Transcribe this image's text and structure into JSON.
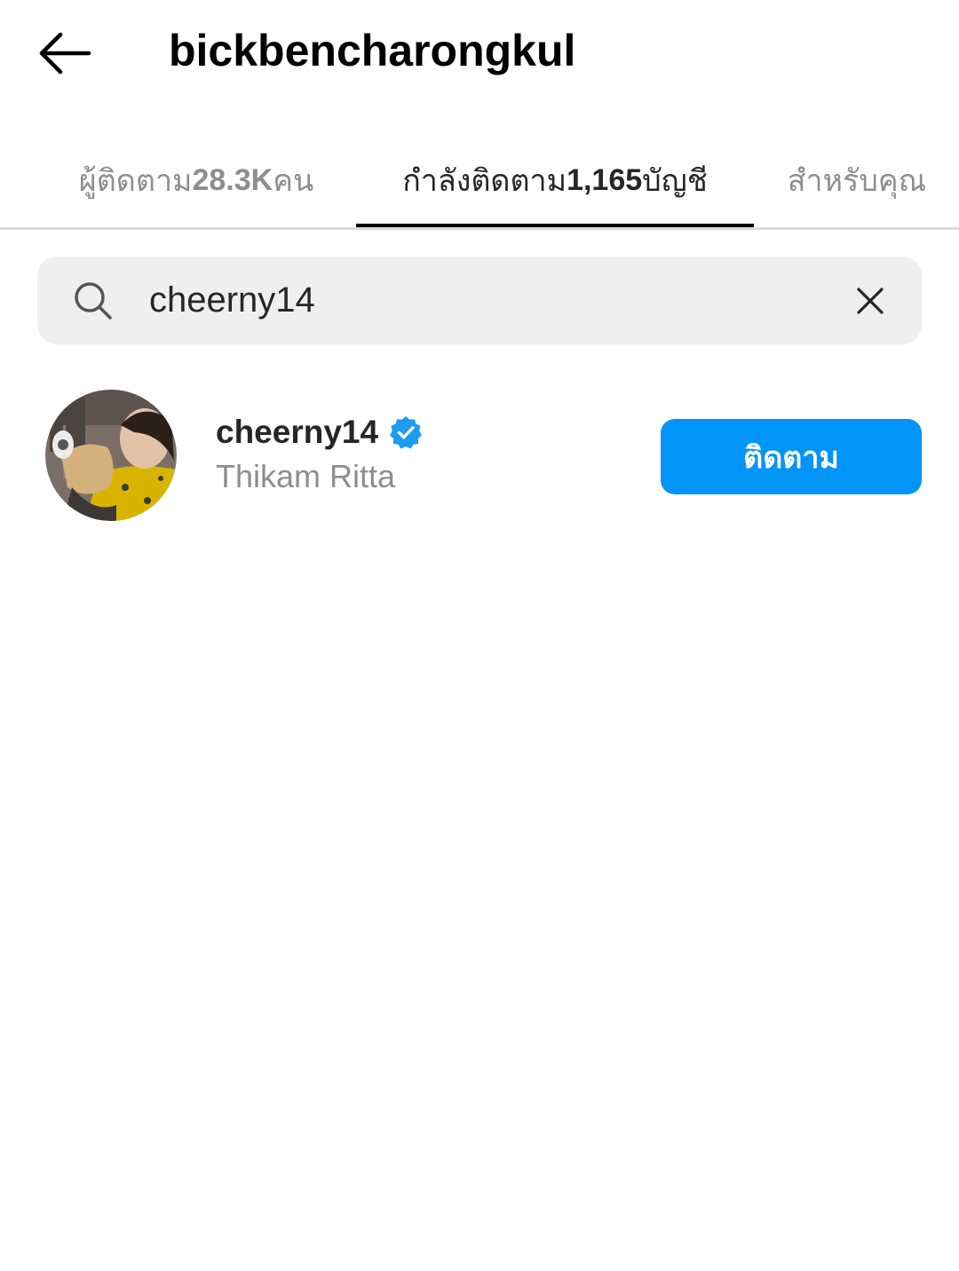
{
  "header": {
    "title": "bickbencharongkul",
    "back_icon": "arrow-left-icon"
  },
  "tabs": {
    "partial_label": "ı",
    "items": [
      {
        "label_before": "ผู้ติดตาม ",
        "count": "28.3K",
        "label_after": " คน",
        "active": false
      },
      {
        "label_before": "กำลังติดตาม ",
        "count": "1,165",
        "label_after": " บัญชี",
        "active": true
      },
      {
        "label_before": "สำหรับคุณ",
        "count": "",
        "label_after": "",
        "active": false
      }
    ]
  },
  "search": {
    "value": "cheerny14",
    "search_icon": "search-icon",
    "clear_icon": "close-icon"
  },
  "results": [
    {
      "username": "cheerny14",
      "full_name": "Thikam Ritta",
      "verified": true,
      "follow_label": "ติดตาม"
    }
  ],
  "colors": {
    "accent": "#0095f6",
    "text_primary": "#262626",
    "text_secondary": "#8e8e8e",
    "search_bg": "#efefef",
    "divider": "#dbdbdb"
  }
}
